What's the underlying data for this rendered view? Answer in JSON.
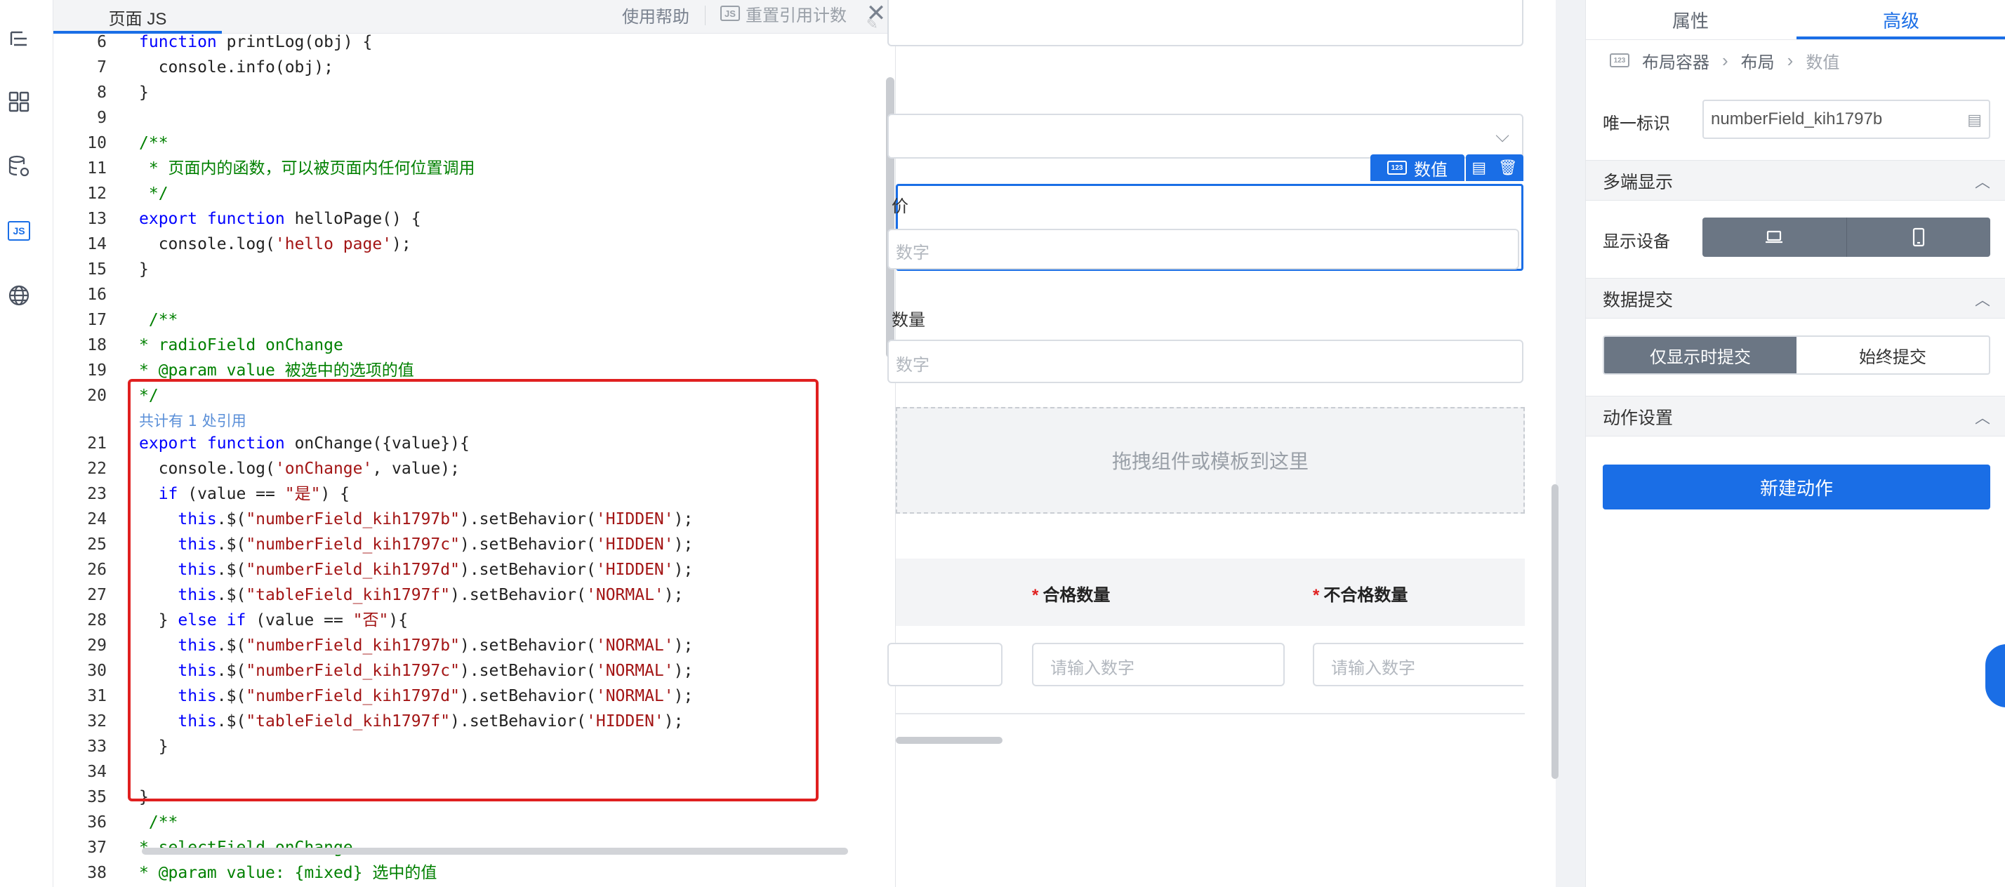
{
  "editor": {
    "tab_label": "页面 JS",
    "help_label": "使用帮助",
    "reset_label": "重置引用计数",
    "js_badge": "JS",
    "close_glyph": "✕"
  },
  "rail": {
    "icons": [
      "outline-icon",
      "components-icon",
      "datasource-icon",
      "js-icon",
      "globe-icon"
    ],
    "js_label": "JS"
  },
  "code": {
    "ref_hint": "共计有 1 处引用",
    "lines": [
      {
        "n": "6",
        "html": "<span class='kw'>function</span> printLog(obj) {"
      },
      {
        "n": "7",
        "html": "  console.info(obj);"
      },
      {
        "n": "8",
        "html": "}"
      },
      {
        "n": "9",
        "html": ""
      },
      {
        "n": "10",
        "html": "<span class='cm'>/**</span>"
      },
      {
        "n": "11",
        "html": "<span class='cm'> * 页面内的函数，可以被页面内任何位置调用</span>"
      },
      {
        "n": "12",
        "html": "<span class='cm'> */</span>"
      },
      {
        "n": "13",
        "html": "<span class='kw'>export</span> <span class='kw'>function</span> helloPage() {"
      },
      {
        "n": "14",
        "html": "  console.log(<span class='str'>'hello page'</span>);"
      },
      {
        "n": "15",
        "html": "}"
      },
      {
        "n": "16",
        "html": ""
      },
      {
        "n": "17",
        "html": "<span class='cm'> /**</span>"
      },
      {
        "n": "18",
        "html": "<span class='cm'>* radioField onChange</span>"
      },
      {
        "n": "19",
        "html": "<span class='cm'>* @param value 被选中的选项的值</span>"
      },
      {
        "n": "20",
        "html": "<span class='cm'>*/</span>"
      },
      {
        "n": "21",
        "html": "<span class='kw'>export</span> <span class='kw'>function</span> onChange({value}){"
      },
      {
        "n": "22",
        "html": "  console.log(<span class='str'>'onChange'</span>, value);"
      },
      {
        "n": "23",
        "html": "  <span class='kw'>if</span> (value == <span class='str'>\"是\"</span>) {"
      },
      {
        "n": "24",
        "html": "    <span class='kw'>this</span>.$(<span class='str'>\"numberField_kih1797b\"</span>).setBehavior(<span class='str'>'HIDDEN'</span>);"
      },
      {
        "n": "25",
        "html": "    <span class='kw'>this</span>.$(<span class='str'>\"numberField_kih1797c\"</span>).setBehavior(<span class='str'>'HIDDEN'</span>);"
      },
      {
        "n": "26",
        "html": "    <span class='kw'>this</span>.$(<span class='str'>\"numberField_kih1797d\"</span>).setBehavior(<span class='str'>'HIDDEN'</span>);"
      },
      {
        "n": "27",
        "html": "    <span class='kw'>this</span>.$(<span class='str'>\"tableField_kih1797f\"</span>).setBehavior(<span class='str'>'NORMAL'</span>);"
      },
      {
        "n": "28",
        "html": "  } <span class='kw'>else</span> <span class='kw'>if</span> (value == <span class='str'>\"否\"</span>){"
      },
      {
        "n": "29",
        "html": "    <span class='kw'>this</span>.$(<span class='str'>\"numberField_kih1797b\"</span>).setBehavior(<span class='str'>'NORMAL'</span>);"
      },
      {
        "n": "30",
        "html": "    <span class='kw'>this</span>.$(<span class='str'>\"numberField_kih1797c\"</span>).setBehavior(<span class='str'>'NORMAL'</span>);"
      },
      {
        "n": "31",
        "html": "    <span class='kw'>this</span>.$(<span class='str'>\"numberField_kih1797d\"</span>).setBehavior(<span class='str'>'NORMAL'</span>);"
      },
      {
        "n": "32",
        "html": "    <span class='kw'>this</span>.$(<span class='str'>\"tableField_kih1797f\"</span>).setBehavior(<span class='str'>'HIDDEN'</span>);"
      },
      {
        "n": "33",
        "html": "  }"
      },
      {
        "n": "34",
        "html": ""
      },
      {
        "n": "35",
        "html": "}"
      },
      {
        "n": "36",
        "html": "<span class='cm'> /**</span>"
      },
      {
        "n": "37",
        "html": "<span class='cm'>* selectField onChange</span>"
      },
      {
        "n": "38",
        "html": "<span class='cm'>* @param value: {mixed} 选中的值</span>"
      }
    ]
  },
  "canvas": {
    "selected_tag": "数值",
    "field_label_partial": "价",
    "field_placeholder_partial": "数字",
    "qty_label_partial": "数量",
    "qty_placeholder_partial": "数字",
    "drop_zone_text": "拖拽组件或模板到这里",
    "table": {
      "required_mark": "*",
      "col_pass": "合格数量",
      "col_fail": "不合格数量",
      "placeholder": "请输入数字"
    }
  },
  "props": {
    "tabs": [
      {
        "label": "属性",
        "active": false
      },
      {
        "label": "高级",
        "active": true
      }
    ],
    "breadcrumb": [
      "布局容器",
      "布局",
      "数值"
    ],
    "id_label": "唯一标识",
    "id_value": "numberField_kih1797b",
    "sections": {
      "multi_display": "多端显示",
      "device_label": "显示设备",
      "data_submit": "数据提交",
      "submit_options": [
        "仅显示时提交",
        "始终提交"
      ],
      "action_settings": "动作设置",
      "new_action": "新建动作"
    }
  },
  "colors": {
    "accent": "#1a6ee6",
    "highlight": "#e02020",
    "segment_active": "#6b7684"
  }
}
